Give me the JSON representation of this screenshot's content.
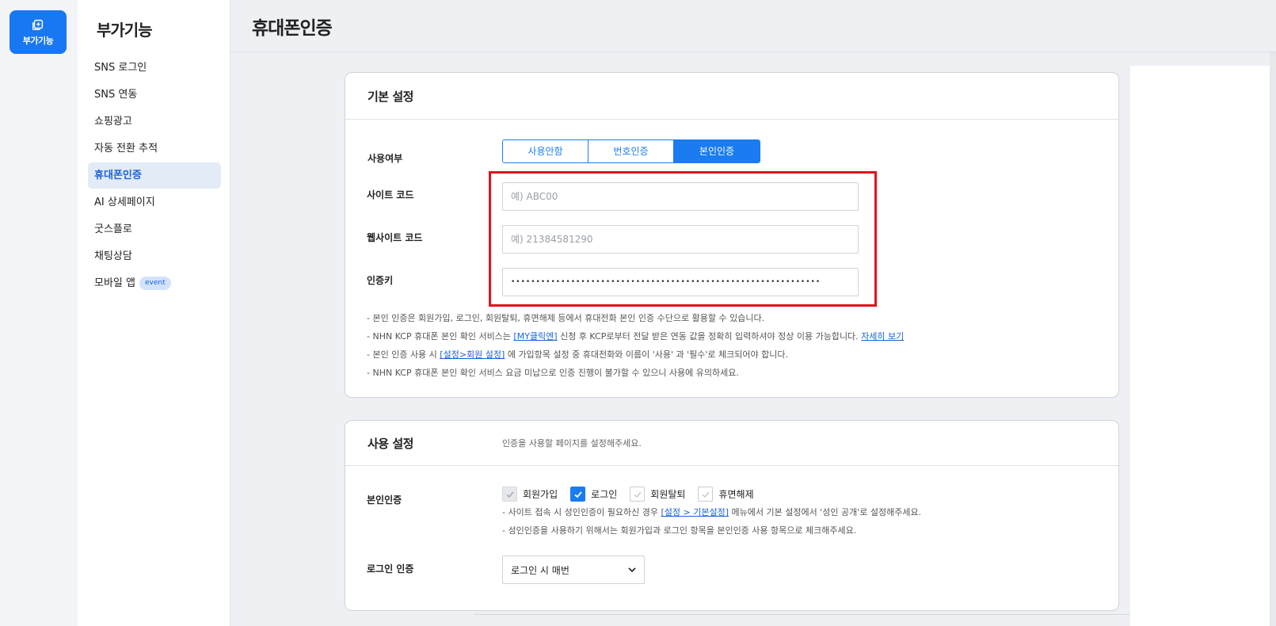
{
  "rail": {
    "label": "부가기능"
  },
  "sidebar": {
    "title": "부가기능",
    "items": [
      {
        "label": "SNS 로그인"
      },
      {
        "label": "SNS 연동"
      },
      {
        "label": "쇼핑광고"
      },
      {
        "label": "자동 전환 추적"
      },
      {
        "label": "휴대폰인증",
        "active": true
      },
      {
        "label": "AI 상세페이지"
      },
      {
        "label": "굿스플로"
      },
      {
        "label": "채팅상담"
      },
      {
        "label": "모바일 앱",
        "badge": "event"
      }
    ]
  },
  "header": {
    "title": "휴대폰인증"
  },
  "basic": {
    "title": "기본 설정",
    "usage_label": "사용여부",
    "usage_options": [
      "사용안함",
      "번호인증",
      "본인인증"
    ],
    "usage_selected": "본인인증",
    "site_code_label": "사이트 코드",
    "site_code_placeholder": "예) ABC00",
    "website_code_label": "웹사이트 코드",
    "website_code_placeholder": "예) 21384581290",
    "auth_key_label": "인증키",
    "auth_key_value": "••••••••••••••••••••••••••••••••••••••••••••••••••••••••••••••",
    "notes": {
      "n1": "본인 인증은 회원가입, 로그인, 회원탈퇴, 휴면해제 등에서 휴대전화 본인 인증 수단으로 활용할 수 있습니다.",
      "n2_pre": "NHN KCP 휴대폰 본인 확인 서비스는 ",
      "n2_link": "[MY클릭엔]",
      "n2_mid": " 신청 후 KCP로부터 전달 받은 연동 값을 정확히 입력하셔야 정상 이용 가능합니다. ",
      "n2_link2": "자세히 보기",
      "n3_pre": "본인 인증 사용 시 ",
      "n3_link": "[설정>회원 설정]",
      "n3_post": " 에 가입항목 설정 중 휴대전화와 이름이 '사용' 과 '필수'로 체크되어야 합니다.",
      "n4": "NHN KCP 휴대폰 본인 확인 서비스 요금 미납으로 인증 진행이 불가할 수 있으니 사용에 유의하세요."
    }
  },
  "usage": {
    "title": "사용 설정",
    "description": "인증을 사용할 페이지를 설정해주세요.",
    "identity_label": "본인인증",
    "checks": [
      {
        "label": "회원가입",
        "state": "disabled-checked"
      },
      {
        "label": "로그인",
        "state": "checked"
      },
      {
        "label": "회원탈퇴",
        "state": "unchecked"
      },
      {
        "label": "휴면해제",
        "state": "unchecked"
      }
    ],
    "notes": {
      "n1_pre": "사이트 접속 시 성인인증이 필요하신 경우 ",
      "n1_link": "[설정 > 기본설정]",
      "n1_post": " 메뉴에서 기본 설정에서 '성인 공개'로 설정해주세요.",
      "n2": "성인인증을 사용하기 위해서는 회원가입과 로그인 항목을 본인인증 사용 항목으로 체크해주세요."
    },
    "login_auth_label": "로그인 인증",
    "login_auth_value": "로그인 시 매번"
  },
  "colors": {
    "accent": "#1a7cf0",
    "highlight": "#e0131e",
    "rail": "#1877f2"
  }
}
